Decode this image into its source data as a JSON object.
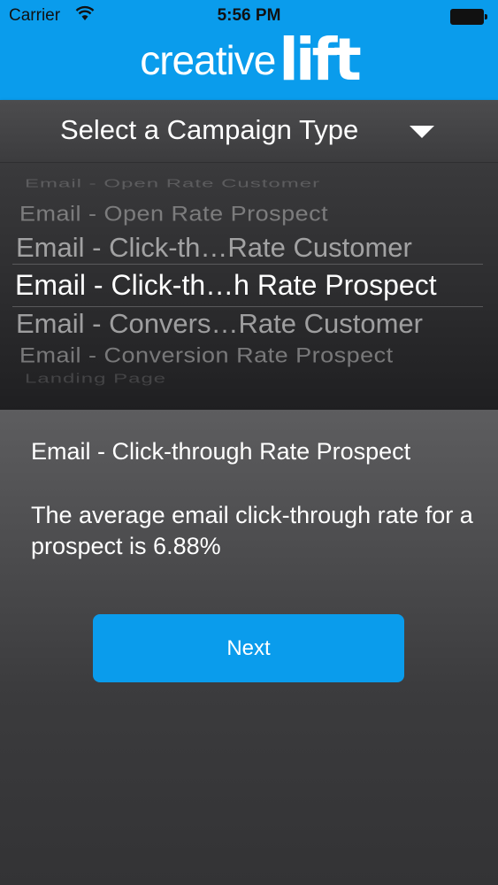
{
  "status_bar": {
    "carrier": "Carrier",
    "time": "5:56 PM"
  },
  "header": {
    "logo_part1": "creative",
    "logo_part2": "lift"
  },
  "selector": {
    "label": "Select a Campaign Type"
  },
  "picker": {
    "items": [
      "Email - Open Rate Customer",
      "Email - Open Rate Prospect",
      "Email - Click-th…Rate Customer",
      "Email - Click-th…h Rate Prospect",
      "Email - Convers…Rate Customer",
      "Email - Conversion Rate Prospect",
      "Landing Page"
    ],
    "selected_index": 3
  },
  "detail": {
    "title": "Email - Click-through Rate Prospect",
    "description": "The average email click-through rate for a prospect is 6.88%"
  },
  "actions": {
    "next_label": "Next"
  },
  "colors": {
    "brand_blue": "#0a9cec",
    "dark_bg": "#3a3a3c"
  },
  "icons": {
    "wifi": "wifi-icon",
    "battery": "battery-icon",
    "dropdown": "triangle-down-icon"
  }
}
